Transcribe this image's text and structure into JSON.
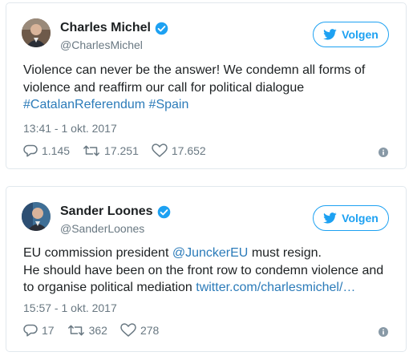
{
  "colors": {
    "link": "#2b7bb9",
    "verified": "#1da1f2",
    "follow": "#1da1f2",
    "secondary_text": "#697882",
    "border": "#e1e8ed"
  },
  "tweets": [
    {
      "author": {
        "name": "Charles Michel",
        "handle": "@CharlesMichel",
        "verified_icon": "verified-badge-icon",
        "avatar": "avatar-photo"
      },
      "follow_button": {
        "icon": "twitter-bird-icon",
        "label": "Volgen"
      },
      "text": {
        "line1": "Violence can never be the answer! We condemn all forms of",
        "line2": "violence and reaffirm our call for political dialogue",
        "hashtag1": "#CatalanReferendum",
        "hashtag2": "#Spain"
      },
      "timestamp": "13:41 - 1 okt. 2017",
      "actions": {
        "replies": "1.145",
        "retweets": "17.251",
        "likes": "17.652"
      },
      "info_icon": "info-icon"
    },
    {
      "author": {
        "name": "Sander Loones",
        "handle": "@SanderLoones",
        "verified_icon": "verified-badge-icon",
        "avatar": "avatar-photo"
      },
      "follow_button": {
        "icon": "twitter-bird-icon",
        "label": "Volgen"
      },
      "text": {
        "line1_prefix": "EU commission president",
        "mention": "@JunckerEU",
        "line1_suffix": "must resign.",
        "line2": "He should have been on the front row to condemn violence and",
        "line3_prefix": "to organise political mediation",
        "url": "twitter.com/charlesmichel/…"
      },
      "timestamp": "15:57 - 1 okt. 2017",
      "actions": {
        "replies": "17",
        "retweets": "362",
        "likes": "278"
      },
      "info_icon": "info-icon"
    }
  ]
}
